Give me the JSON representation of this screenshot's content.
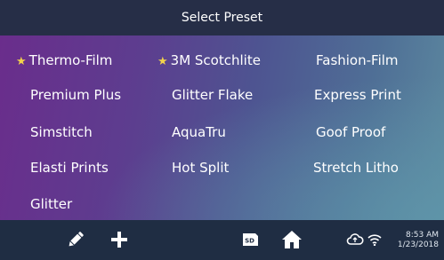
{
  "header": {
    "title": "Select Preset"
  },
  "presets": [
    {
      "label": "Thermo-Film",
      "favorite": true
    },
    {
      "label": "3M Scotchlite",
      "favorite": true
    },
    {
      "label": "Fashion-Film",
      "favorite": false
    },
    {
      "label": "Premium Plus",
      "favorite": false
    },
    {
      "label": "Glitter Flake",
      "favorite": false
    },
    {
      "label": "Express Print",
      "favorite": false
    },
    {
      "label": "Simstitch",
      "favorite": false
    },
    {
      "label": "AquaTru",
      "favorite": false
    },
    {
      "label": "Goof Proof",
      "favorite": false
    },
    {
      "label": "Elasti Prints",
      "favorite": false
    },
    {
      "label": "Hot Split",
      "favorite": false
    },
    {
      "label": "Stretch Litho",
      "favorite": false
    },
    {
      "label": "Glitter",
      "favorite": false
    }
  ],
  "star_symbol": "★",
  "footer": {
    "icons": [
      "pencil-icon",
      "plus-icon",
      "sd-card-icon",
      "home-icon",
      "cloud-sync-icon",
      "wifi-icon"
    ],
    "sd_label": "SD",
    "time": "8:53 AM",
    "date": "1/23/2018"
  },
  "colors": {
    "titlebar": "#262e47",
    "bottombar": "#1f2d43",
    "star": "#f3d34a",
    "text": "#ffffff"
  }
}
